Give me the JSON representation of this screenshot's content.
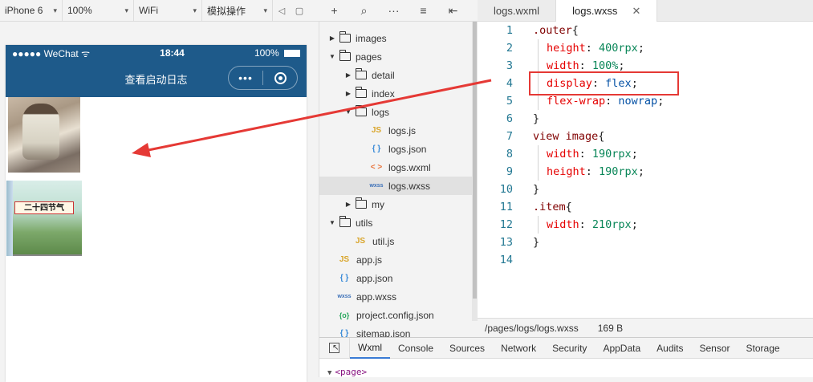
{
  "simulator_toolbar": {
    "device": "iPhone 6",
    "zoom": "100%",
    "network": "WiFi",
    "operation": "模拟操作"
  },
  "phone": {
    "carrier": "●●●●● WeChat",
    "wifi_icon": "wifi-icon",
    "time": "18:44",
    "battery": "100%",
    "nav_title": "查看启动日志",
    "menu_dots": "•••",
    "book_title": "二十四节气"
  },
  "file_tree": {
    "items": [
      {
        "label": "images",
        "type": "folder",
        "expanded": false,
        "depth": 0
      },
      {
        "label": "pages",
        "type": "folder",
        "expanded": true,
        "depth": 0
      },
      {
        "label": "detail",
        "type": "folder",
        "expanded": false,
        "depth": 1
      },
      {
        "label": "index",
        "type": "folder",
        "expanded": false,
        "depth": 1
      },
      {
        "label": "logs",
        "type": "folder",
        "expanded": true,
        "depth": 1
      },
      {
        "label": "logs.js",
        "type": "js",
        "depth": 2,
        "icon_text": "JS"
      },
      {
        "label": "logs.json",
        "type": "json",
        "depth": 2,
        "icon_text": "{ }"
      },
      {
        "label": "logs.wxml",
        "type": "wxml",
        "depth": 2,
        "icon_text": "< >"
      },
      {
        "label": "logs.wxss",
        "type": "wxss",
        "depth": 2,
        "icon_text": "wxss",
        "selected": true
      },
      {
        "label": "my",
        "type": "folder",
        "expanded": false,
        "depth": 1
      },
      {
        "label": "utils",
        "type": "folder",
        "expanded": true,
        "depth": 0
      },
      {
        "label": "util.js",
        "type": "js",
        "depth": 1,
        "icon_text": "JS"
      },
      {
        "label": "app.js",
        "type": "js",
        "depth": 0,
        "icon_text": "JS"
      },
      {
        "label": "app.json",
        "type": "json",
        "depth": 0,
        "icon_text": "{ }"
      },
      {
        "label": "app.wxss",
        "type": "wxss",
        "depth": 0,
        "icon_text": "wxss"
      },
      {
        "label": "project.config.json",
        "type": "cfg",
        "depth": 0,
        "icon_text": "{o}"
      },
      {
        "label": "sitemap.json",
        "type": "json",
        "depth": 0,
        "icon_text": "{ }"
      }
    ]
  },
  "editor": {
    "tabs": [
      {
        "label": "logs.wxml",
        "active": false
      },
      {
        "label": "logs.wxss",
        "active": true,
        "close": "✕"
      }
    ],
    "lines": [
      {
        "n": "1",
        "parts": [
          [
            "sel",
            ".outer"
          ],
          [
            "punct",
            "{"
          ]
        ],
        "indent": false
      },
      {
        "n": "2",
        "parts": [
          [
            "prop",
            "height"
          ],
          [
            "punct",
            ": "
          ],
          [
            "val",
            "400rpx"
          ],
          [
            "punct",
            ";"
          ]
        ],
        "indent": true
      },
      {
        "n": "3",
        "parts": [
          [
            "prop",
            "width"
          ],
          [
            "punct",
            ": "
          ],
          [
            "val",
            "100%"
          ],
          [
            "punct",
            ";"
          ]
        ],
        "indent": true
      },
      {
        "n": "4",
        "parts": [
          [
            "prop",
            "display"
          ],
          [
            "punct",
            ": "
          ],
          [
            "kw",
            "flex"
          ],
          [
            "punct",
            ";"
          ]
        ],
        "indent": true
      },
      {
        "n": "5",
        "parts": [
          [
            "prop",
            "flex-wrap"
          ],
          [
            "punct",
            ": "
          ],
          [
            "kw",
            "nowrap"
          ],
          [
            "punct",
            ";"
          ]
        ],
        "indent": true
      },
      {
        "n": "6",
        "parts": [
          [
            "punct",
            "}"
          ]
        ],
        "indent": false
      },
      {
        "n": "7",
        "parts": [
          [
            "sel",
            "view image"
          ],
          [
            "punct",
            "{"
          ]
        ],
        "indent": false
      },
      {
        "n": "8",
        "parts": [
          [
            "prop",
            "width"
          ],
          [
            "punct",
            ": "
          ],
          [
            "val",
            "190rpx"
          ],
          [
            "punct",
            ";"
          ]
        ],
        "indent": true
      },
      {
        "n": "9",
        "parts": [
          [
            "prop",
            "height"
          ],
          [
            "punct",
            ": "
          ],
          [
            "val",
            "190rpx"
          ],
          [
            "punct",
            ";"
          ]
        ],
        "indent": true
      },
      {
        "n": "10",
        "parts": [
          [
            "punct",
            "}"
          ]
        ],
        "indent": false
      },
      {
        "n": "11",
        "parts": [
          [
            "sel",
            ".item"
          ],
          [
            "punct",
            "{"
          ]
        ],
        "indent": false
      },
      {
        "n": "12",
        "parts": [
          [
            "prop",
            "width"
          ],
          [
            "punct",
            ": "
          ],
          [
            "val",
            "210rpx"
          ],
          [
            "punct",
            ";"
          ]
        ],
        "indent": true
      },
      {
        "n": "13",
        "parts": [
          [
            "punct",
            "}"
          ]
        ],
        "indent": false
      },
      {
        "n": "14",
        "parts": [],
        "indent": false
      }
    ]
  },
  "statusbar": {
    "path": "/pages/logs/logs.wxss",
    "size": "169 B"
  },
  "devtools": {
    "tabs": [
      "Wxml",
      "Console",
      "Sources",
      "Network",
      "Security",
      "AppData",
      "Audits",
      "Sensor",
      "Storage"
    ],
    "active_tab": "Wxml",
    "root_node": "<page>"
  },
  "colors": {
    "nav_bar": "#1e5a8a",
    "annotation_red": "#e53935"
  }
}
